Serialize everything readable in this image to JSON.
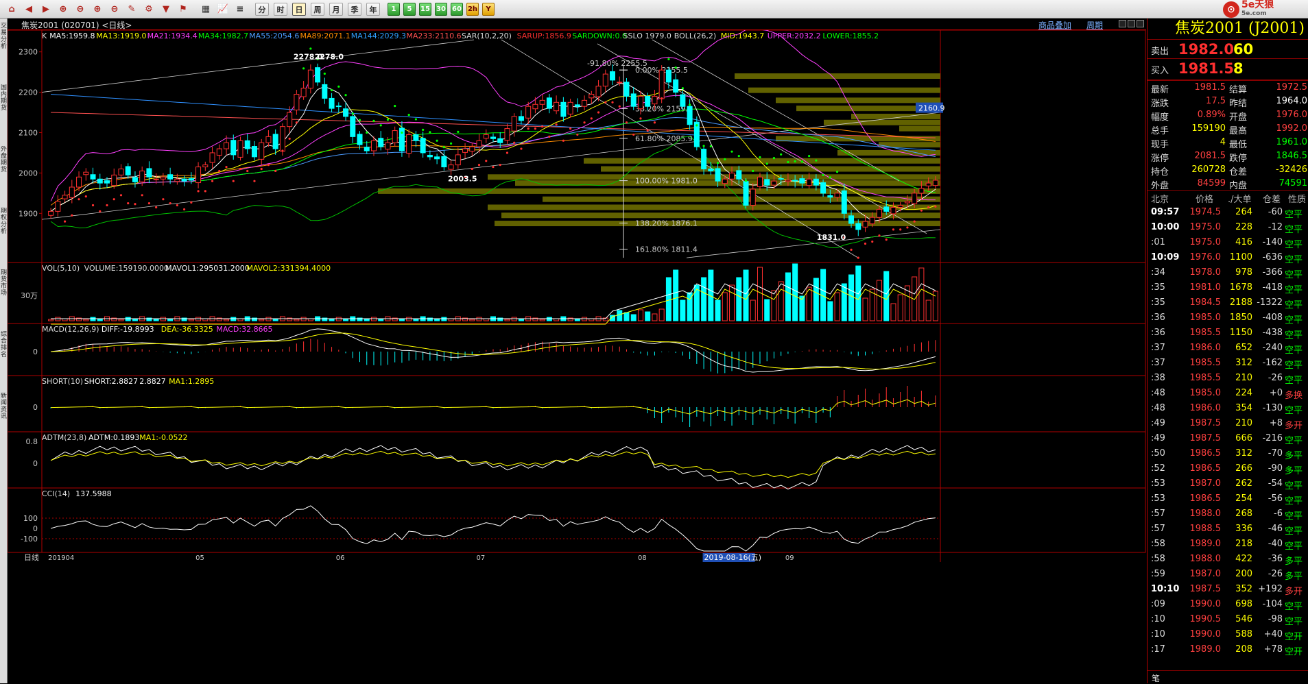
{
  "toolbar": {
    "period_labels": [
      "分",
      "时",
      "日",
      "周",
      "月",
      "季",
      "年"
    ],
    "cycle_labels": [
      "1",
      "5",
      "15",
      "30",
      "60"
    ],
    "extra": [
      "2h",
      "Y"
    ]
  },
  "left_tabs": [
    "交易分析",
    "国内期货",
    "外盘期货",
    "期权分析",
    "期货市场",
    "综合排名",
    "新闻资讯"
  ],
  "header": {
    "title": "焦炭2001 (020701) <日线>",
    "overlay_link": "商品叠加",
    "cycle_link": "周期"
  },
  "quote": {
    "name": "焦炭2001 (J2001)",
    "sell_label": "卖出",
    "sell_price": "1982.0",
    "sell_vol": "60",
    "buy_label": "买入",
    "buy_price": "1981.5",
    "buy_vol": "8",
    "stats": [
      {
        "l1": "最新",
        "v1": "1981.5",
        "c1": "#ff4040",
        "l2": "结算",
        "v2": "1972.5",
        "c2": "#ff4040"
      },
      {
        "l1": "涨跌",
        "v1": "17.5",
        "c1": "#ff4040",
        "l2": "昨结",
        "v2": "1964.0",
        "c2": "#ffffff"
      },
      {
        "l1": "幅度",
        "v1": "0.89%",
        "c1": "#ff4040",
        "l2": "开盘",
        "v2": "1976.0",
        "c2": "#ff4040"
      },
      {
        "l1": "总手",
        "v1": "159190",
        "c1": "#ffff00",
        "l2": "最高",
        "v2": "1992.0",
        "c2": "#ff4040"
      },
      {
        "l1": "现手",
        "v1": "4",
        "c1": "#ffff00",
        "l2": "最低",
        "v2": "1961.0",
        "c2": "#00ff00"
      },
      {
        "l1": "涨停",
        "v1": "2081.5",
        "c1": "#ff4040",
        "l2": "跌停",
        "v2": "1846.5",
        "c2": "#00ff00"
      },
      {
        "l1": "持仓",
        "v1": "260728",
        "c1": "#ffff00",
        "l2": "仓差",
        "v2": "-32426",
        "c2": "#ffff00"
      },
      {
        "l1": "外盘",
        "v1": "84599",
        "c1": "#ff4040",
        "l2": "内盘",
        "v2": "74591",
        "c2": "#00ff00"
      }
    ],
    "trade_head": {
      "time": "北京",
      "price": "价格",
      "vol": "./大单",
      "oi": "仓差",
      "nature": "性质"
    },
    "trades": [
      {
        "t": "09:57",
        "p": "1974.5",
        "v": "264",
        "oi": "-60",
        "n": "空平",
        "nc": "#00ff00",
        "s": 1
      },
      {
        "t": "10:00",
        "p": "1975.0",
        "v": "228",
        "oi": "-12",
        "n": "空平",
        "nc": "#00ff00",
        "s": 1
      },
      {
        "t": ":01",
        "p": "1975.0",
        "v": "416",
        "oi": "-140",
        "n": "空平",
        "nc": "#00ff00",
        "s": 0
      },
      {
        "t": "10:09",
        "p": "1976.0",
        "v": "1100",
        "oi": "-636",
        "n": "空平",
        "nc": "#00ff00",
        "s": 1
      },
      {
        "t": ":34",
        "p": "1978.0",
        "v": "978",
        "oi": "-366",
        "n": "空平",
        "nc": "#00ff00",
        "s": 0
      },
      {
        "t": ":35",
        "p": "1981.0",
        "v": "1678",
        "oi": "-418",
        "n": "空平",
        "nc": "#00ff00",
        "s": 0
      },
      {
        "t": ":35",
        "p": "1984.5",
        "v": "2188",
        "oi": "-1322",
        "n": "空平",
        "nc": "#00ff00",
        "s": 0
      },
      {
        "t": ":36",
        "p": "1985.0",
        "v": "1850",
        "oi": "-408",
        "n": "空平",
        "nc": "#00ff00",
        "s": 0
      },
      {
        "t": ":36",
        "p": "1985.5",
        "v": "1150",
        "oi": "-438",
        "n": "空平",
        "nc": "#00ff00",
        "s": 0
      },
      {
        "t": ":37",
        "p": "1986.0",
        "v": "652",
        "oi": "-240",
        "n": "空平",
        "nc": "#00ff00",
        "s": 0
      },
      {
        "t": ":37",
        "p": "1985.5",
        "v": "312",
        "oi": "-162",
        "n": "空平",
        "nc": "#00ff00",
        "s": 0
      },
      {
        "t": ":38",
        "p": "1985.5",
        "v": "210",
        "oi": "-26",
        "n": "空平",
        "nc": "#00ff00",
        "s": 0
      },
      {
        "t": ":48",
        "p": "1985.0",
        "v": "224",
        "oi": "+0",
        "n": "多换",
        "nc": "#ff4040",
        "s": 0
      },
      {
        "t": ":48",
        "p": "1986.0",
        "v": "354",
        "oi": "-130",
        "n": "空平",
        "nc": "#00ff00",
        "s": 0
      },
      {
        "t": ":49",
        "p": "1987.5",
        "v": "210",
        "oi": "+8",
        "n": "多开",
        "nc": "#ff4040",
        "s": 0
      },
      {
        "t": ":49",
        "p": "1987.5",
        "v": "666",
        "oi": "-216",
        "n": "空平",
        "nc": "#00ff00",
        "s": 0
      },
      {
        "t": ":50",
        "p": "1986.5",
        "v": "312",
        "oi": "-70",
        "n": "多平",
        "nc": "#00ff00",
        "s": 0
      },
      {
        "t": ":52",
        "p": "1986.5",
        "v": "266",
        "oi": "-90",
        "n": "多平",
        "nc": "#00ff00",
        "s": 0
      },
      {
        "t": ":53",
        "p": "1987.0",
        "v": "262",
        "oi": "-54",
        "n": "空平",
        "nc": "#00ff00",
        "s": 0
      },
      {
        "t": ":53",
        "p": "1986.5",
        "v": "254",
        "oi": "-56",
        "n": "空平",
        "nc": "#00ff00",
        "s": 0
      },
      {
        "t": ":57",
        "p": "1988.0",
        "v": "268",
        "oi": "-6",
        "n": "空平",
        "nc": "#00ff00",
        "s": 0
      },
      {
        "t": ":57",
        "p": "1988.5",
        "v": "336",
        "oi": "-46",
        "n": "空平",
        "nc": "#00ff00",
        "s": 0
      },
      {
        "t": ":58",
        "p": "1989.0",
        "v": "218",
        "oi": "-40",
        "n": "空平",
        "nc": "#00ff00",
        "s": 0
      },
      {
        "t": ":58",
        "p": "1988.0",
        "v": "422",
        "oi": "-36",
        "n": "多平",
        "nc": "#00ff00",
        "s": 0
      },
      {
        "t": ":59",
        "p": "1987.0",
        "v": "200",
        "oi": "-26",
        "n": "多平",
        "nc": "#00ff00",
        "s": 0
      },
      {
        "t": "10:10",
        "p": "1987.5",
        "v": "352",
        "oi": "+192",
        "n": "多开",
        "nc": "#ff4040",
        "s": 1
      },
      {
        "t": ":09",
        "p": "1990.0",
        "v": "698",
        "oi": "-104",
        "n": "空平",
        "nc": "#00ff00",
        "s": 0
      },
      {
        "t": ":10",
        "p": "1990.5",
        "v": "546",
        "oi": "-98",
        "n": "空平",
        "nc": "#00ff00",
        "s": 0
      },
      {
        "t": ":10",
        "p": "1990.0",
        "v": "588",
        "oi": "+40",
        "n": "空开",
        "nc": "#00ff00",
        "s": 0
      },
      {
        "t": ":17",
        "p": "1989.0",
        "v": "208",
        "oi": "+78",
        "n": "空开",
        "nc": "#00ff00",
        "s": 0
      }
    ],
    "footer": "笔"
  },
  "chart_data": {
    "type": "candlestick",
    "price_range": [
      1780,
      2330
    ],
    "yticks": [
      1900,
      2000,
      2100,
      2200,
      2300
    ],
    "ma_legend": [
      {
        "t": "K",
        "c": "#dddddd"
      },
      {
        "t": "MA5:1959.8",
        "c": "#ffffff"
      },
      {
        "t": "MA13:1919.0",
        "c": "#ffff00"
      },
      {
        "t": "MA21:1934.4",
        "c": "#ff40ff"
      },
      {
        "t": "MA34:1982.7",
        "c": "#00ff00"
      },
      {
        "t": "MA55:2054.6",
        "c": "#4b9bff"
      },
      {
        "t": "MA89:2071.1",
        "c": "#ff8c00"
      },
      {
        "t": "MA144:2029.3",
        "c": "#2fa0ff"
      },
      {
        "t": "MA233:2110.6",
        "c": "#ff5050"
      },
      {
        "t": "SAR(10,2,20)",
        "c": "#dddddd"
      },
      {
        "t": "SARUP:1856.9",
        "c": "#ff3030"
      },
      {
        "t": "SARDOWN:0.0",
        "c": "#00ff00"
      },
      {
        "t": "SSLO 1979.0",
        "c": "#dddddd"
      },
      {
        "t": "BOLL(26,2)",
        "c": "#dddddd"
      },
      {
        "t": "MID:1943.7",
        "c": "#ffff00"
      },
      {
        "t": "UPPER:2032.2",
        "c": "#ff40ff"
      },
      {
        "t": "LOWER:1855.2",
        "c": "#00ff00"
      }
    ],
    "closes": [
      1905,
      1930,
      1945,
      1965,
      1990,
      2002,
      1985,
      1975,
      1975,
      1995,
      2010,
      1995,
      1978,
      2005,
      1990,
      1985,
      1990,
      1985,
      1985,
      1980,
      1982,
      2015,
      2020,
      2050,
      2060,
      2075,
      2045,
      2080,
      2060,
      2040,
      2075,
      2090,
      2060,
      2115,
      2150,
      2195,
      2210,
      2255,
      2225,
      2185,
      2160,
      2165,
      2140,
      2090,
      2070,
      2055,
      2080,
      2065,
      2075,
      2105,
      2055,
      2095,
      2080,
      2050,
      2040,
      2035,
      2015,
      2020,
      2045,
      2060,
      2065,
      2080,
      2095,
      2085,
      2075,
      2110,
      2140,
      2130,
      2165,
      2170,
      2180,
      2160,
      2175,
      2140,
      2175,
      2165,
      2180,
      2195,
      2215,
      2245,
      2230,
      2225,
      2190,
      2165,
      2190,
      2165,
      2190,
      2255,
      2225,
      2200,
      2165,
      2120,
      2065,
      2010,
      2005,
      1980,
      1985,
      2000,
      1985,
      1920,
      1960,
      1990,
      1970,
      1980,
      1985,
      1982,
      1980,
      1975,
      1985,
      1970,
      1950,
      1940,
      1950,
      1900,
      1875,
      1860,
      1880,
      1890,
      1910,
      1905,
      1915,
      1920,
      1930,
      1950,
      1962,
      1975,
      1982
    ],
    "annotations": [
      {
        "t": "2278.0",
        "px": 2278,
        "i": 37
      },
      {
        "t": "2278.0",
        "px": 2278,
        "i": 40
      },
      {
        "t": "2003.5",
        "px": 2003,
        "i": 59
      },
      {
        "t": "1831.0",
        "px": 1831,
        "i": 113
      }
    ],
    "fib": [
      {
        "t": "-91.80%",
        "v": "2255.5"
      },
      {
        "t": "0.00%",
        "v": "2255.5"
      },
      {
        "t": "38.20%",
        "v": "2159.6"
      },
      {
        "t": "61.80%",
        "v": "2085.9"
      },
      {
        "t": "100.00%",
        "v": "1981.0"
      },
      {
        "t": "138.20%",
        "v": "1876.1"
      },
      {
        "t": "161.80%",
        "v": "1811.4"
      }
    ],
    "price_tag": "2160.9",
    "vol_legend": [
      {
        "t": "VOL(5,10)",
        "c": "#dddddd"
      },
      {
        "t": "VOLUME:159190.0000",
        "c": "#dddddd"
      },
      {
        "t": "MAVOL1:295031.2000",
        "c": "#ffffff"
      },
      {
        "t": "MAVOL2:331394.4000",
        "c": "#ffff00"
      }
    ],
    "vol_tick": "30万",
    "macd_legend": [
      {
        "t": "MACD(12,26,9)",
        "c": "#dddddd"
      },
      {
        "t": "DIFF:-19.8993",
        "c": "#ffffff"
      },
      {
        "t": "DEA:-36.3325",
        "c": "#ffff00"
      },
      {
        "t": "MACD:32.8665",
        "c": "#ff40ff"
      }
    ],
    "short_legend": [
      {
        "t": "SHORT(10)",
        "c": "#dddddd"
      },
      {
        "t": "SHORT:2.8827",
        "c": "#ffffff"
      },
      {
        "t": "2.8827",
        "c": "#ffffff"
      },
      {
        "t": "MA1:1.2895",
        "c": "#ffff00"
      }
    ],
    "adtm_legend": [
      {
        "t": "ADTM(23,8)",
        "c": "#dddddd"
      },
      {
        "t": "ADTM:0.1893",
        "c": "#ffffff"
      },
      {
        "t": "MA1:-0.0522",
        "c": "#ffff00"
      }
    ],
    "adtm_ticks": [
      "0.8",
      "0"
    ],
    "cci_legend": [
      {
        "t": "CCI(14)",
        "c": "#dddddd"
      },
      {
        "t": "137.5988",
        "c": "#ffffff"
      }
    ],
    "cci_ticks": [
      "100",
      "0",
      "-100"
    ],
    "zero": "0",
    "x_labels": [
      {
        "t": "201904",
        "i": 0
      },
      {
        "t": "05",
        "i": 21
      },
      {
        "t": "06",
        "i": 41
      },
      {
        "t": "07",
        "i": 61
      },
      {
        "t": "08",
        "i": 84
      },
      {
        "t": "09",
        "i": 105
      }
    ],
    "x_cursor": "2019-08-16(五)",
    "x_label_period": "日线"
  }
}
